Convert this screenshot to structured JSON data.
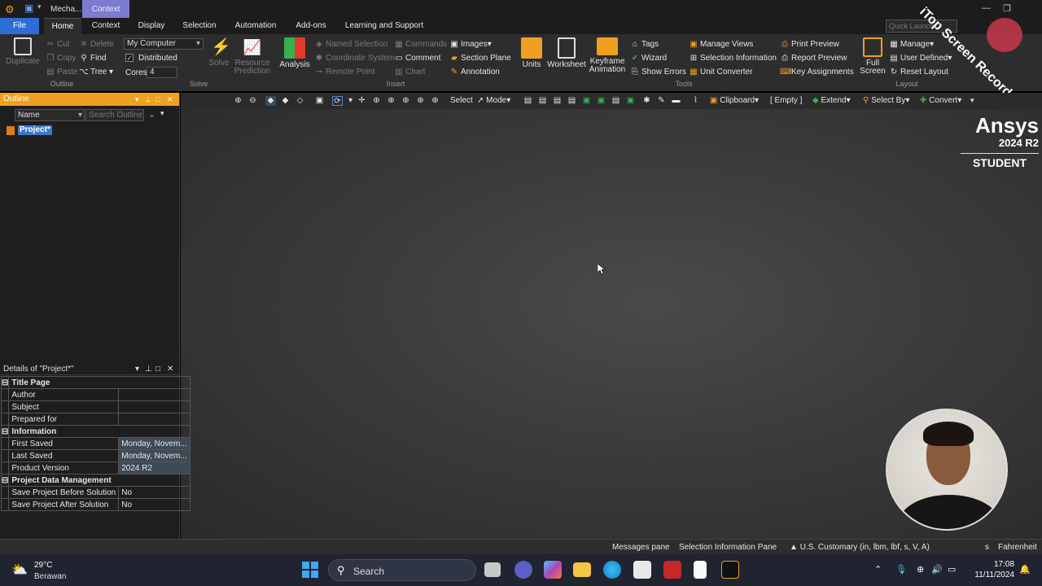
{
  "titlebar": {
    "title": "Mecha...",
    "context_tab": "Context",
    "quick_launch_placeholder": "Quick Launch"
  },
  "ribbon_tabs": [
    "File",
    "Home",
    "Context",
    "Display",
    "Selection",
    "Automation",
    "Add-ons",
    "Learning and Support"
  ],
  "ribbon": {
    "outline": {
      "duplicate": "Duplicate",
      "cut": "Cut",
      "copy": "Copy",
      "paste": "Paste",
      "delete": "Delete",
      "find": "Find",
      "tree": "Tree",
      "label": "Outline"
    },
    "solve": {
      "computer": "My Computer",
      "distributed": "Distributed",
      "cores_label": "Cores",
      "cores_value": "4",
      "solve": "Solve",
      "resource_prediction_1": "Resource",
      "resource_prediction_2": "Prediction",
      "label": "Solve"
    },
    "insert": {
      "analysis": "Analysis",
      "named_selection": "Named Selection",
      "coordinate_system": "Coordinate System",
      "remote_point": "Remote Point",
      "commands": "Commands",
      "comment": "Comment",
      "chart": "Chart",
      "images": "Images",
      "section_plane": "Section Plane",
      "annotation": "Annotation",
      "label": "Insert"
    },
    "tools": {
      "units": "Units",
      "worksheet": "Worksheet",
      "keyframe_1": "Keyframe",
      "keyframe_2": "Animation",
      "tags": "Tags",
      "wizard": "Wizard",
      "show_errors": "Show Errors",
      "manage_views": "Manage Views",
      "selection_information": "Selection Information",
      "unit_converter": "Unit Converter",
      "print_preview": "Print Preview",
      "report_preview": "Report Preview",
      "key_assignments": "Key Assignments",
      "label": "Tools"
    },
    "layout": {
      "full_1": "Full",
      "full_2": "Screen",
      "manage": "Manage",
      "user_defined": "User Defined",
      "reset_layout": "Reset Layout",
      "label": "Layout"
    }
  },
  "watermark": {
    "recorder": "iTop Screen Recorder",
    "brand": "Ansys",
    "version": "2024 R2",
    "edition": "STUDENT"
  },
  "graphics_toolbar": {
    "select": "Select",
    "mode": "Mode",
    "clipboard": "Clipboard",
    "empty": "[ Empty ]",
    "extend": "Extend",
    "select_by": "Select By",
    "convert": "Convert"
  },
  "outline": {
    "title": "Outline",
    "filter_name": "Name",
    "search_placeholder": "Search Outline",
    "project": "Project*"
  },
  "details": {
    "title": "Details of \"Project*\"",
    "sections": [
      {
        "name": "Title Page",
        "rows": [
          {
            "key": "Author",
            "value": ""
          },
          {
            "key": "Subject",
            "value": ""
          },
          {
            "key": "Prepared for",
            "value": ""
          }
        ]
      },
      {
        "name": "Information",
        "rows": [
          {
            "key": "First Saved",
            "value": "Monday, Novem..."
          },
          {
            "key": "Last Saved",
            "value": "Monday, Novem..."
          },
          {
            "key": "Product Version",
            "value": "2024 R2"
          }
        ]
      },
      {
        "name": "Project Data Management",
        "rows": [
          {
            "key": "Save Project Before Solution",
            "value": "No"
          },
          {
            "key": "Save Project After Solution",
            "value": "No"
          }
        ]
      }
    ]
  },
  "statusbar": {
    "messages": "Messages pane",
    "selection_info": "Selection Information Pane",
    "units": "U.S. Customary (in, lbm, lbf, s, V, A)",
    "degrees_partial": "s",
    "temperature": "Fahrenheit"
  },
  "taskbar": {
    "temperature": "29°C",
    "weather": "Berawan",
    "search": "Search",
    "time": "17:08",
    "date": "11/11/2024"
  }
}
